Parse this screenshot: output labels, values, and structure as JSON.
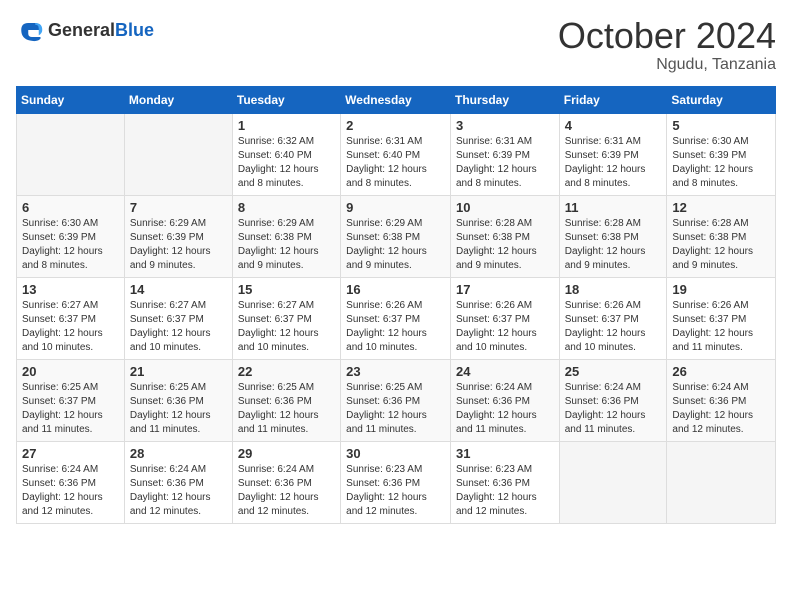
{
  "header": {
    "logo_general": "General",
    "logo_blue": "Blue",
    "month": "October 2024",
    "location": "Ngudu, Tanzania"
  },
  "weekdays": [
    "Sunday",
    "Monday",
    "Tuesday",
    "Wednesday",
    "Thursday",
    "Friday",
    "Saturday"
  ],
  "weeks": [
    [
      null,
      null,
      {
        "day": 1,
        "sunrise": "6:32 AM",
        "sunset": "6:40 PM",
        "daylight": "12 hours and 8 minutes."
      },
      {
        "day": 2,
        "sunrise": "6:31 AM",
        "sunset": "6:40 PM",
        "daylight": "12 hours and 8 minutes."
      },
      {
        "day": 3,
        "sunrise": "6:31 AM",
        "sunset": "6:39 PM",
        "daylight": "12 hours and 8 minutes."
      },
      {
        "day": 4,
        "sunrise": "6:31 AM",
        "sunset": "6:39 PM",
        "daylight": "12 hours and 8 minutes."
      },
      {
        "day": 5,
        "sunrise": "6:30 AM",
        "sunset": "6:39 PM",
        "daylight": "12 hours and 8 minutes."
      }
    ],
    [
      {
        "day": 6,
        "sunrise": "6:30 AM",
        "sunset": "6:39 PM",
        "daylight": "12 hours and 8 minutes."
      },
      {
        "day": 7,
        "sunrise": "6:29 AM",
        "sunset": "6:39 PM",
        "daylight": "12 hours and 9 minutes."
      },
      {
        "day": 8,
        "sunrise": "6:29 AM",
        "sunset": "6:38 PM",
        "daylight": "12 hours and 9 minutes."
      },
      {
        "day": 9,
        "sunrise": "6:29 AM",
        "sunset": "6:38 PM",
        "daylight": "12 hours and 9 minutes."
      },
      {
        "day": 10,
        "sunrise": "6:28 AM",
        "sunset": "6:38 PM",
        "daylight": "12 hours and 9 minutes."
      },
      {
        "day": 11,
        "sunrise": "6:28 AM",
        "sunset": "6:38 PM",
        "daylight": "12 hours and 9 minutes."
      },
      {
        "day": 12,
        "sunrise": "6:28 AM",
        "sunset": "6:38 PM",
        "daylight": "12 hours and 9 minutes."
      }
    ],
    [
      {
        "day": 13,
        "sunrise": "6:27 AM",
        "sunset": "6:37 PM",
        "daylight": "12 hours and 10 minutes."
      },
      {
        "day": 14,
        "sunrise": "6:27 AM",
        "sunset": "6:37 PM",
        "daylight": "12 hours and 10 minutes."
      },
      {
        "day": 15,
        "sunrise": "6:27 AM",
        "sunset": "6:37 PM",
        "daylight": "12 hours and 10 minutes."
      },
      {
        "day": 16,
        "sunrise": "6:26 AM",
        "sunset": "6:37 PM",
        "daylight": "12 hours and 10 minutes."
      },
      {
        "day": 17,
        "sunrise": "6:26 AM",
        "sunset": "6:37 PM",
        "daylight": "12 hours and 10 minutes."
      },
      {
        "day": 18,
        "sunrise": "6:26 AM",
        "sunset": "6:37 PM",
        "daylight": "12 hours and 10 minutes."
      },
      {
        "day": 19,
        "sunrise": "6:26 AM",
        "sunset": "6:37 PM",
        "daylight": "12 hours and 11 minutes."
      }
    ],
    [
      {
        "day": 20,
        "sunrise": "6:25 AM",
        "sunset": "6:37 PM",
        "daylight": "12 hours and 11 minutes."
      },
      {
        "day": 21,
        "sunrise": "6:25 AM",
        "sunset": "6:36 PM",
        "daylight": "12 hours and 11 minutes."
      },
      {
        "day": 22,
        "sunrise": "6:25 AM",
        "sunset": "6:36 PM",
        "daylight": "12 hours and 11 minutes."
      },
      {
        "day": 23,
        "sunrise": "6:25 AM",
        "sunset": "6:36 PM",
        "daylight": "12 hours and 11 minutes."
      },
      {
        "day": 24,
        "sunrise": "6:24 AM",
        "sunset": "6:36 PM",
        "daylight": "12 hours and 11 minutes."
      },
      {
        "day": 25,
        "sunrise": "6:24 AM",
        "sunset": "6:36 PM",
        "daylight": "12 hours and 11 minutes."
      },
      {
        "day": 26,
        "sunrise": "6:24 AM",
        "sunset": "6:36 PM",
        "daylight": "12 hours and 12 minutes."
      }
    ],
    [
      {
        "day": 27,
        "sunrise": "6:24 AM",
        "sunset": "6:36 PM",
        "daylight": "12 hours and 12 minutes."
      },
      {
        "day": 28,
        "sunrise": "6:24 AM",
        "sunset": "6:36 PM",
        "daylight": "12 hours and 12 minutes."
      },
      {
        "day": 29,
        "sunrise": "6:24 AM",
        "sunset": "6:36 PM",
        "daylight": "12 hours and 12 minutes."
      },
      {
        "day": 30,
        "sunrise": "6:23 AM",
        "sunset": "6:36 PM",
        "daylight": "12 hours and 12 minutes."
      },
      {
        "day": 31,
        "sunrise": "6:23 AM",
        "sunset": "6:36 PM",
        "daylight": "12 hours and 12 minutes."
      },
      null,
      null
    ]
  ]
}
